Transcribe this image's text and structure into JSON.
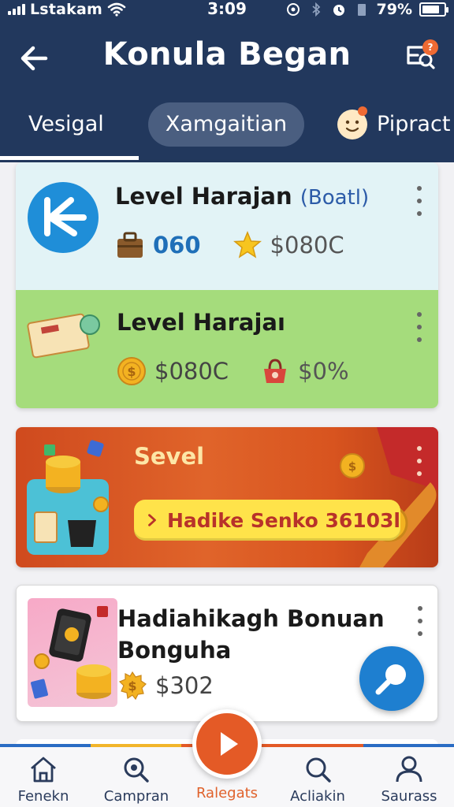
{
  "status_bar": {
    "carrier": "Lstakam",
    "time": "3:09",
    "battery": "79%",
    "battery_level": 0.79
  },
  "header": {
    "title": "Konula Began",
    "action_badge": "?"
  },
  "tabs": [
    {
      "label": "Vesigal",
      "active": true
    },
    {
      "label": "Xamgaitian",
      "highlighted": true
    },
    {
      "label": "Pipract"
    }
  ],
  "cards": {
    "level_1": {
      "title": "Level Harajan",
      "tag": "(Boatl)",
      "stat_1": "060",
      "stat_2": "$080C"
    },
    "level_2": {
      "title": "Level Harajaı",
      "stat_1": "$080C",
      "stat_2": "$0%"
    },
    "promo": {
      "title": "Sevel",
      "cta": "Hadike Senko 36103l"
    },
    "bonus": {
      "title": "Hadiahikagh Bonuan Bonguha",
      "amount": "$302"
    }
  },
  "bottom_nav": [
    {
      "label": "Fenekn",
      "icon": "home-icon"
    },
    {
      "label": "Campran",
      "icon": "search-icon"
    },
    {
      "label": "Ralegats",
      "icon": "play-icon",
      "active": true
    },
    {
      "label": "Acliakin",
      "icon": "search-icon"
    },
    {
      "label": "Saurass",
      "icon": "user-icon"
    }
  ],
  "colors": {
    "header": "#22385d",
    "accent": "#e45a26",
    "card_blue": "#e2f3f6",
    "card_green": "#a5dc7c",
    "fab": "#1e7fd0"
  }
}
